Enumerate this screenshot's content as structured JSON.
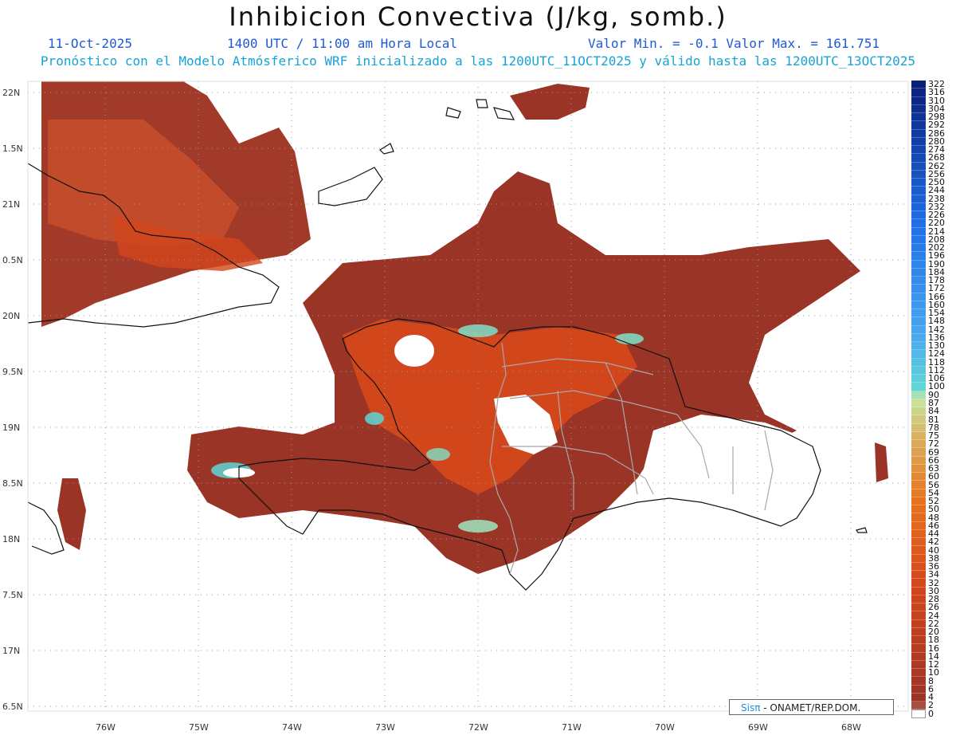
{
  "title": "Inhibicion Convectiva (J/kg, somb.)",
  "header": {
    "date": "11-Oct-2025",
    "time": "1400 UTC / 11:00 am Hora Local",
    "min_max": "Valor Min. = -0.1  Valor Max. = 161.751",
    "forecast": "Pronóstico con el Modelo Atmósferico WRF inicializado a las 1200UTC_11OCT2025 y válido hasta las  1200UTC_13OCT2025"
  },
  "latitude_labels": [
    "22N",
    "1.5N",
    "21N",
    "0.5N",
    "20N",
    "9.5N",
    "19N",
    "8.5N",
    "18N",
    "7.5N",
    "17N",
    "6.5N"
  ],
  "longitude_labels": [
    "76W",
    "75W",
    "74W",
    "73W",
    "72W",
    "71W",
    "70W",
    "69W",
    "68W"
  ],
  "colorbar": {
    "labels": [
      "322",
      "316",
      "310",
      "304",
      "298",
      "292",
      "286",
      "280",
      "274",
      "268",
      "262",
      "256",
      "250",
      "244",
      "238",
      "232",
      "226",
      "220",
      "214",
      "208",
      "202",
      "196",
      "190",
      "184",
      "178",
      "172",
      "166",
      "160",
      "154",
      "148",
      "142",
      "136",
      "130",
      "124",
      "118",
      "112",
      "106",
      "100",
      "90",
      "87",
      "84",
      "81",
      "78",
      "75",
      "72",
      "69",
      "66",
      "63",
      "60",
      "56",
      "54",
      "52",
      "50",
      "48",
      "46",
      "44",
      "42",
      "40",
      "38",
      "36",
      "34",
      "32",
      "30",
      "28",
      "26",
      "24",
      "22",
      "20",
      "18",
      "16",
      "14",
      "12",
      "10",
      "8",
      "6",
      "4",
      "2",
      "0"
    ],
    "colors": {
      "deep_blue": "#0a1f7a",
      "blue": "#1f6fe6",
      "light_blue": "#4aa8f0",
      "cyan": "#5fd6d6",
      "light_green": "#c8e6a0",
      "tan": "#d8b060",
      "orange": "#e8741e",
      "red_orange": "#d2461c",
      "brown": "#9a3427",
      "white": "#ffffff"
    }
  },
  "credit": {
    "brand": "Sisπ",
    "text": " - ONAMET/REP.DOM."
  }
}
